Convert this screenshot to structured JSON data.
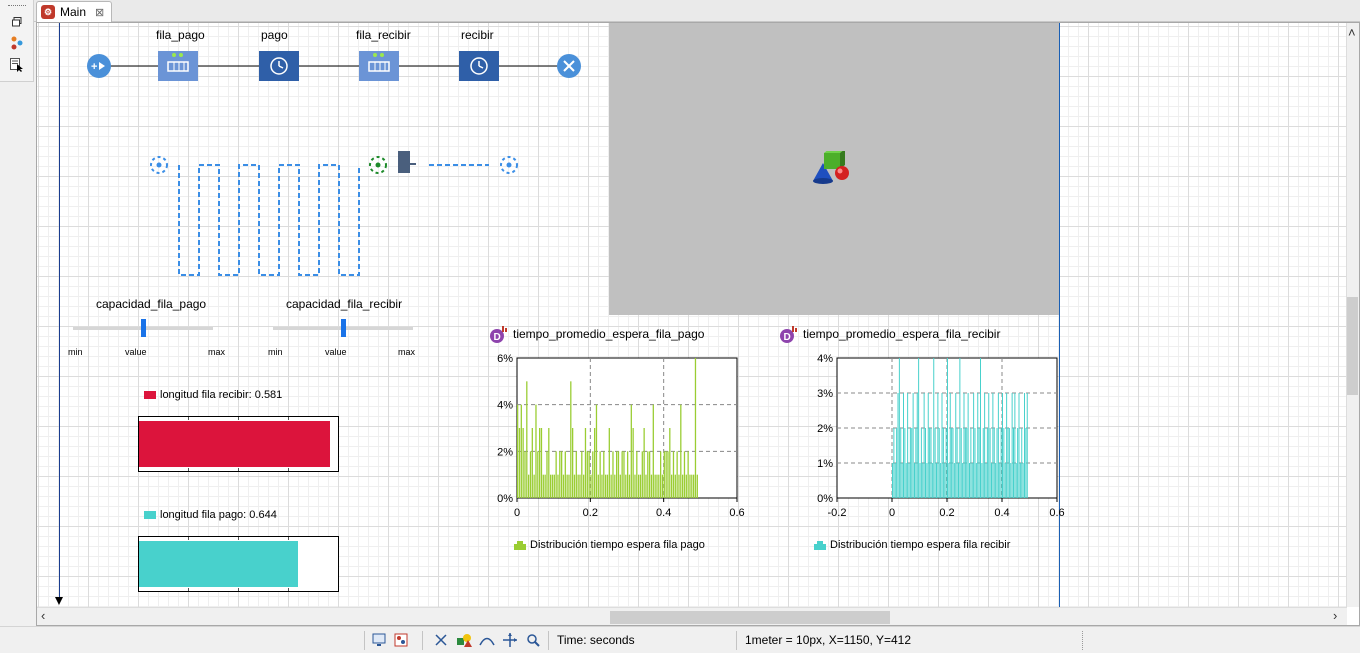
{
  "window": {
    "tab_label": "Main",
    "tab_close": "⊠",
    "tab_icon": "app-icon"
  },
  "left_toolbar": {
    "icons": [
      "restore-window-icon",
      "agents-tree-icon",
      "properties-cursor-icon"
    ]
  },
  "process_flow": {
    "blocks": [
      {
        "id": "source",
        "icon": "source-icon",
        "label": ""
      },
      {
        "id": "fila_pago",
        "icon": "queue-icon",
        "label": "fila_pago"
      },
      {
        "id": "pago",
        "icon": "clock-icon",
        "label": "pago"
      },
      {
        "id": "fila_recibir",
        "icon": "queue-icon",
        "label": "fila_recibir"
      },
      {
        "id": "recibir",
        "icon": "clock-icon",
        "label": "recibir"
      },
      {
        "id": "sink",
        "icon": "sink-icon",
        "label": ""
      }
    ]
  },
  "sliders": [
    {
      "label": "capacidad_fila_pago",
      "min_label": "min",
      "value_label": "value",
      "max_label": "max",
      "position": 0.5
    },
    {
      "label": "capacidad_fila_recibir",
      "min_label": "min",
      "value_label": "value",
      "max_label": "max",
      "position": 0.5
    }
  ],
  "bar_indicators": [
    {
      "label": "longitud fila recibir: 0.581",
      "color": "#dc143c",
      "fraction": 0.96
    },
    {
      "label": "longitud fila pago: 0.644",
      "color": "#48d1cc",
      "fraction": 0.8
    }
  ],
  "histograms": [
    {
      "title": "tiempo_promedio_espera_fila_pago",
      "icon": "dataset-icon",
      "legend": "Distribución tiempo espera fila pago",
      "color": "#9acd32"
    },
    {
      "title": "tiempo_promedio_espera_fila_recibir",
      "icon": "dataset-icon",
      "legend": "Distribución tiempo espera fila recibir",
      "color": "#48d1cc"
    }
  ],
  "chart_data": [
    {
      "type": "bar",
      "title": "tiempo_promedio_espera_fila_pago",
      "series": [
        {
          "name": "Distribución tiempo espera fila pago",
          "color": "#9acd32"
        }
      ],
      "x": [
        0.0,
        0.005,
        0.01,
        0.015,
        0.02,
        0.025,
        0.03,
        0.035,
        0.04,
        0.045,
        0.05,
        0.055,
        0.06,
        0.065,
        0.07,
        0.075,
        0.08,
        0.085,
        0.09,
        0.095,
        0.1,
        0.105,
        0.11,
        0.115,
        0.12,
        0.125,
        0.13,
        0.135,
        0.14,
        0.145,
        0.15,
        0.155,
        0.16,
        0.165,
        0.17,
        0.175,
        0.18,
        0.185,
        0.19,
        0.195,
        0.2,
        0.205,
        0.21,
        0.215,
        0.22,
        0.225,
        0.23,
        0.235,
        0.24,
        0.245,
        0.25,
        0.255,
        0.26,
        0.265,
        0.27,
        0.275,
        0.28,
        0.285,
        0.29,
        0.295,
        0.3,
        0.305,
        0.31,
        0.315,
        0.32,
        0.325,
        0.33,
        0.335,
        0.34,
        0.345,
        0.35,
        0.355,
        0.36,
        0.365,
        0.37,
        0.375,
        0.38,
        0.385,
        0.39,
        0.395,
        0.4,
        0.405,
        0.41,
        0.415,
        0.42,
        0.425,
        0.43,
        0.435,
        0.44,
        0.445,
        0.45,
        0.455,
        0.46,
        0.465,
        0.47,
        0.475,
        0.48,
        0.485,
        0.49
      ],
      "values": [
        4,
        3,
        4,
        3,
        2,
        5,
        1,
        2,
        3,
        1,
        4,
        2,
        3,
        3,
        1,
        1,
        2,
        3,
        1,
        1,
        1,
        2,
        1,
        2,
        2,
        1,
        2,
        1,
        1,
        5,
        3,
        1,
        2,
        1,
        1,
        2,
        1,
        3,
        2,
        2,
        1,
        2,
        3,
        4,
        1,
        2,
        1,
        2,
        1,
        1,
        3,
        1,
        2,
        1,
        2,
        2,
        1,
        2,
        2,
        1,
        2,
        1,
        4,
        3,
        1,
        2,
        1,
        1,
        2,
        3,
        1,
        2,
        2,
        1,
        4,
        1,
        1,
        1,
        2,
        1,
        2,
        2,
        2,
        3,
        1,
        2,
        1,
        2,
        1,
        4,
        1,
        2,
        1,
        2,
        1,
        1,
        1,
        6,
        1
      ],
      "xlim": [
        0,
        0.6
      ],
      "ylim": [
        0,
        6
      ],
      "x_ticks": [
        "0",
        "0.2",
        "0.4",
        "0.6"
      ],
      "y_ticks": [
        "0%",
        "2%",
        "4%",
        "6%"
      ],
      "grid": true,
      "legend": "bottom"
    },
    {
      "type": "bar",
      "title": "tiempo_promedio_espera_fila_recibir",
      "series": [
        {
          "name": "Distribución tiempo espera fila recibir",
          "color": "#48d1cc"
        }
      ],
      "x": [
        0.0,
        0.005,
        0.01,
        0.015,
        0.02,
        0.025,
        0.03,
        0.035,
        0.04,
        0.045,
        0.05,
        0.055,
        0.06,
        0.065,
        0.07,
        0.075,
        0.08,
        0.085,
        0.09,
        0.095,
        0.1,
        0.105,
        0.11,
        0.115,
        0.12,
        0.125,
        0.13,
        0.135,
        0.14,
        0.145,
        0.15,
        0.155,
        0.16,
        0.165,
        0.17,
        0.175,
        0.18,
        0.185,
        0.19,
        0.195,
        0.2,
        0.205,
        0.21,
        0.215,
        0.22,
        0.225,
        0.23,
        0.235,
        0.24,
        0.245,
        0.25,
        0.255,
        0.26,
        0.265,
        0.27,
        0.275,
        0.28,
        0.285,
        0.29,
        0.295,
        0.3,
        0.305,
        0.31,
        0.315,
        0.32,
        0.325,
        0.33,
        0.335,
        0.34,
        0.345,
        0.35,
        0.355,
        0.36,
        0.365,
        0.37,
        0.375,
        0.38,
        0.385,
        0.39,
        0.395,
        0.4,
        0.405,
        0.41,
        0.415,
        0.42,
        0.425,
        0.43,
        0.435,
        0.44,
        0.445,
        0.45,
        0.455,
        0.46,
        0.465,
        0.47,
        0.475,
        0.48,
        0.485,
        0.49
      ],
      "values": [
        1,
        2,
        1,
        2,
        3,
        4,
        2,
        1,
        3,
        2,
        1,
        3,
        1,
        2,
        2,
        3,
        1,
        2,
        3,
        4,
        1,
        2,
        1,
        3,
        2,
        1,
        3,
        2,
        2,
        1,
        4,
        2,
        1,
        3,
        2,
        1,
        3,
        2,
        1,
        2,
        4,
        1,
        3,
        2,
        2,
        1,
        3,
        2,
        1,
        4,
        2,
        1,
        3,
        2,
        2,
        3,
        1,
        2,
        1,
        3,
        2,
        1,
        3,
        2,
        4,
        1,
        2,
        3,
        1,
        2,
        3,
        2,
        1,
        3,
        2,
        1,
        2,
        3,
        1,
        2,
        3,
        2,
        1,
        3,
        2,
        2,
        1,
        3,
        2,
        3,
        1,
        2,
        3,
        1,
        2,
        1,
        3,
        2,
        3
      ],
      "xlim": [
        -0.2,
        0.6
      ],
      "ylim": [
        0,
        4
      ],
      "x_ticks": [
        "-0.2",
        "0",
        "0.2",
        "0.4",
        "0.6"
      ],
      "y_ticks": [
        "0%",
        "1%",
        "2%",
        "3%",
        "4%"
      ],
      "grid": true,
      "legend": "bottom"
    }
  ],
  "status_bar": {
    "time_units": "Time: seconds",
    "coords": "1meter = 10px, X=1150, Y=412",
    "icons": [
      "screen-icon",
      "palette-icon",
      "connect-icon",
      "shapes-icon",
      "curve-icon",
      "move-icon",
      "zoom-icon"
    ]
  }
}
